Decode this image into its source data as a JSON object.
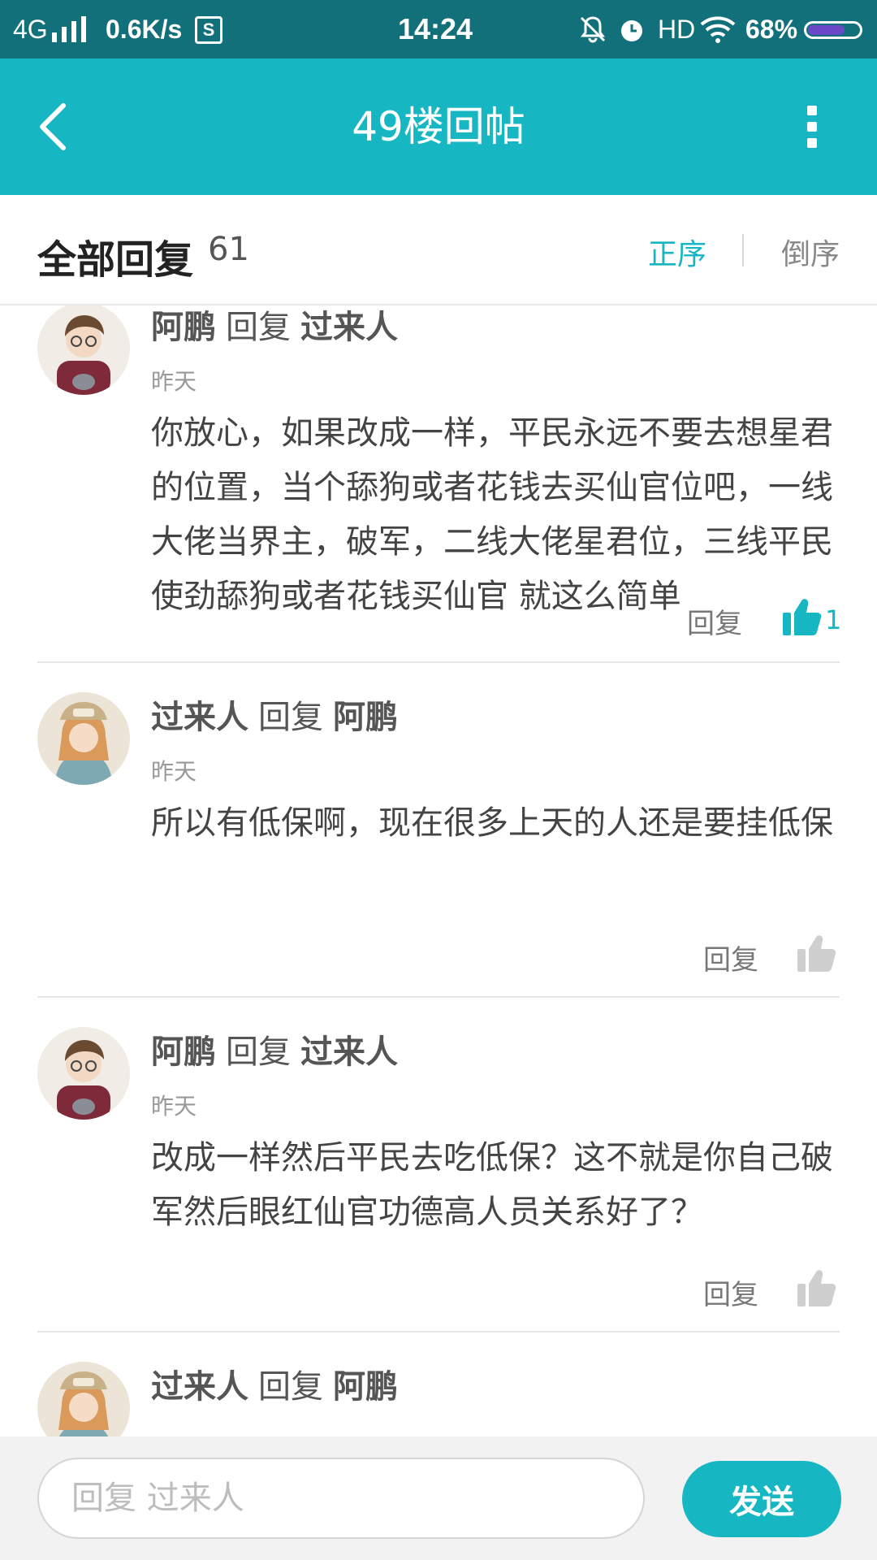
{
  "status_bar": {
    "network": "4G",
    "speed": "0.6K/s",
    "sim_label": "S",
    "time": "14:24",
    "hd": "HD",
    "battery_percent": "68%",
    "battery_level": 0.68
  },
  "header": {
    "title": "49楼回帖",
    "back_icon": "back-chevron-icon",
    "more_icon": "more-vertical-icon"
  },
  "replies_header": {
    "title": "全部回复",
    "count": "61",
    "sort_asc": "正序",
    "sort_desc": "倒序"
  },
  "replies": [
    {
      "author": "阿鹏",
      "verb": "回复",
      "target": "过来人",
      "time": "昨天",
      "body": "你放心，如果改成一样，平民永远不要去想星君的位置，当个舔狗或者花钱去买仙官位吧，一线大佬当界主，破军，二线大佬星君位，三线平民使劲舔狗或者花钱买仙官 就这么简单",
      "reply_label": "回复",
      "likes": "1",
      "liked": true
    },
    {
      "author": "过来人",
      "verb": "回复",
      "target": "阿鹏",
      "time": "昨天",
      "body": "所以有低保啊，现在很多上天的人还是要挂低保",
      "reply_label": "回复",
      "likes": "",
      "liked": false
    },
    {
      "author": "阿鹏",
      "verb": "回复",
      "target": "过来人",
      "time": "昨天",
      "body": "改成一样然后平民去吃低保？这不就是你自己破军然后眼红仙官功德高人员关系好了？",
      "reply_label": "回复",
      "likes": "",
      "liked": false
    },
    {
      "author": "过来人",
      "verb": "回复",
      "target": "阿鹏",
      "time": "",
      "body": "",
      "reply_label": "",
      "likes": "",
      "liked": false
    }
  ],
  "composer": {
    "placeholder": "回复 过来人",
    "send_label": "发送"
  },
  "colors": {
    "accent": "#17b6c3",
    "status_bar": "#12707a",
    "like_inactive": "#cfcfcf"
  }
}
